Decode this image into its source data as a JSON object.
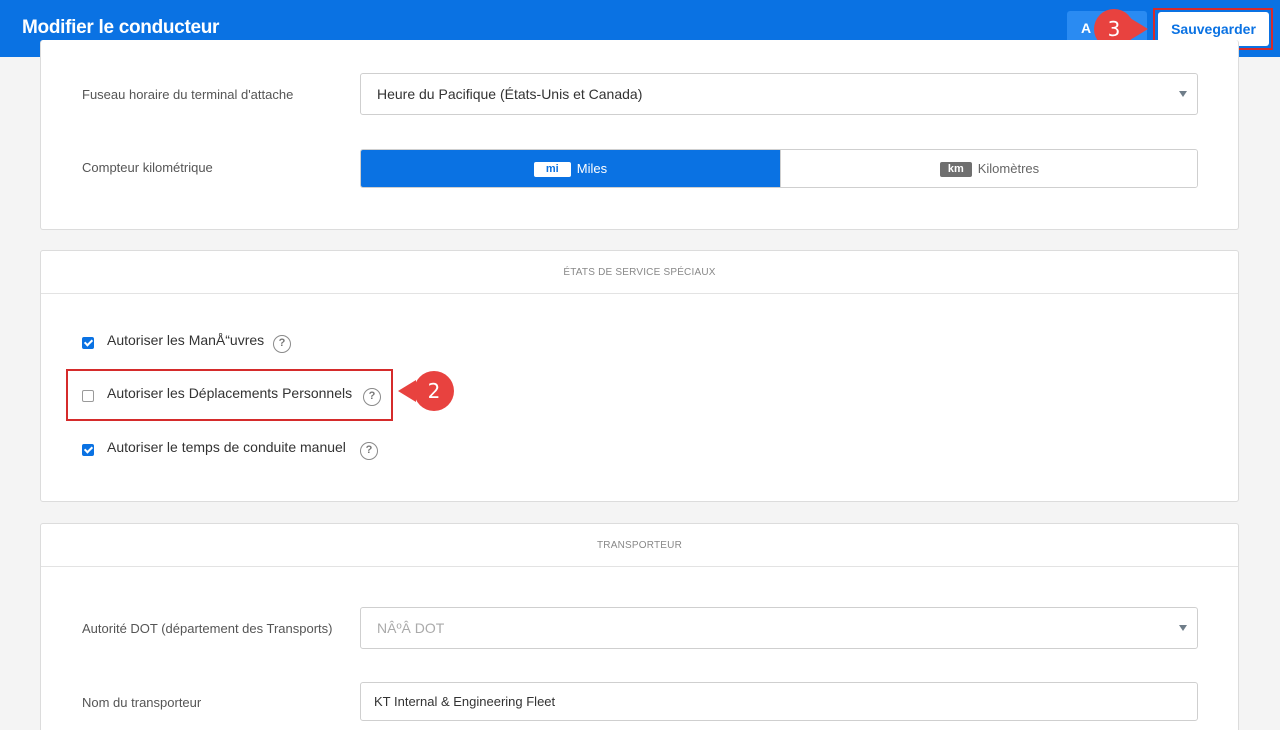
{
  "header": {
    "title": "Modifier le conducteur",
    "cancel_label": "A",
    "save_label": "Sauvegarder"
  },
  "callouts": {
    "step_save": "3",
    "step_personal": "2"
  },
  "general": {
    "timezone_label": "Fuseau horaire du terminal d'attache",
    "timezone_value": "Heure du Pacifique (États-Unis et Canada)",
    "odometer_label": "Compteur kilométrique",
    "odometer_options": [
      {
        "badge": "mi",
        "label": "Miles",
        "selected": true
      },
      {
        "badge": "km",
        "label": "Kilomètres",
        "selected": false
      }
    ]
  },
  "special_duty": {
    "heading": "ÉTATS DE SERVICE SPÉCIAUX",
    "items": [
      {
        "label": "Autoriser les ManÅ“uvres",
        "checked": true
      },
      {
        "label": "Autoriser les Déplacements Personnels",
        "checked": false
      },
      {
        "label": "Autoriser le temps de conduite manuel",
        "checked": true
      }
    ],
    "help_glyph": "?"
  },
  "carrier": {
    "heading": "TRANSPORTEUR",
    "dot_label": "Autorité DOT (département des Transports)",
    "dot_placeholder": "NÂºÂ DOT",
    "name_label": "Nom du transporteur",
    "name_value": "KT Internal & Engineering Fleet"
  },
  "colors": {
    "primary": "#0a72e3",
    "highlight": "#d52b2b",
    "callout": "#e8423f"
  }
}
